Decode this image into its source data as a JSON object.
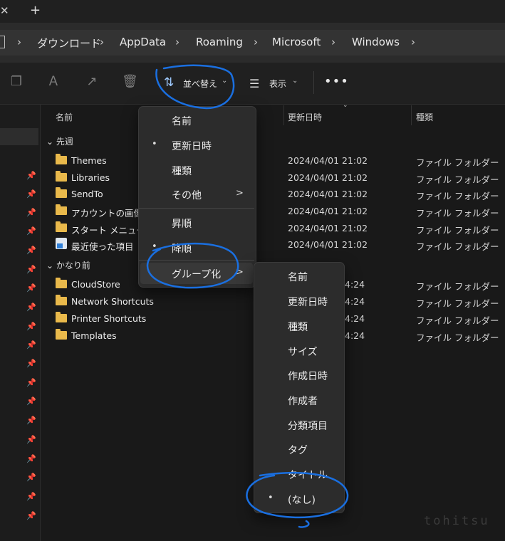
{
  "tabs": {
    "close_icon": "close-icon",
    "new_tab_icon": "plus-icon"
  },
  "breadcrumb": [
    "ダウンロード",
    "AppData",
    "Roaming",
    "Microsoft",
    "Windows"
  ],
  "toolbar": {
    "icons": [
      "copy-icon",
      "rename-icon",
      "share-icon",
      "delete-icon"
    ],
    "sort_label": "並べ替え",
    "view_label": "表示",
    "more_icon": "more-icon"
  },
  "columns": {
    "name": "名前",
    "date": "更新日時",
    "type": "種類"
  },
  "groups": [
    {
      "label": "先週",
      "items": [
        {
          "name": "Themes",
          "date": "2024/04/01 21:02",
          "type": "ファイル フォルダー"
        },
        {
          "name": "Libraries",
          "date": "2024/04/01 21:02",
          "type": "ファイル フォルダー"
        },
        {
          "name": "SendTo",
          "date": "2024/04/01 21:02",
          "type": "ファイル フォルダー"
        },
        {
          "name": "アカウントの画像",
          "date": "2024/04/01 21:02",
          "type": "ファイル フォルダー"
        },
        {
          "name": "スタート メニュー",
          "date": "2024/04/01 21:02",
          "type": "ファイル フォルダー"
        },
        {
          "name": "最近使った項目",
          "date": "2024/04/01 21:02",
          "type": "ファイル フォルダー"
        }
      ]
    },
    {
      "label": "かなり前",
      "items": [
        {
          "name": "CloudStore",
          "date_partial": "4:24",
          "type": "ファイル フォルダー"
        },
        {
          "name": "Network Shortcuts",
          "date_partial": "4:24",
          "type": "ファイル フォルダー"
        },
        {
          "name": "Printer Shortcuts",
          "date_partial": "4:24",
          "type": "ファイル フォルダー"
        },
        {
          "name": "Templates",
          "date_partial": "4:24",
          "type": "ファイル フォルダー"
        }
      ]
    }
  ],
  "sort_menu": {
    "items": [
      "名前",
      "更新日時",
      "種類",
      "その他"
    ],
    "order": [
      "昇順",
      "降順"
    ],
    "group": "グループ化",
    "selected_field": "更新日時",
    "selected_order": "降順",
    "bullet": "•",
    "submenu_arrow": ">"
  },
  "group_menu": {
    "items": [
      "名前",
      "更新日時",
      "種類",
      "サイズ",
      "作成日時",
      "作成者",
      "分類項目",
      "タグ",
      "タイトル",
      "(なし)"
    ],
    "selected": "(なし)",
    "bullet": "•"
  },
  "watermark": "tohitsu",
  "colors": {
    "annotation": "#1a6fe0",
    "folder": "#e9b94b",
    "background": "#191919",
    "menu": "#2c2c2c"
  }
}
